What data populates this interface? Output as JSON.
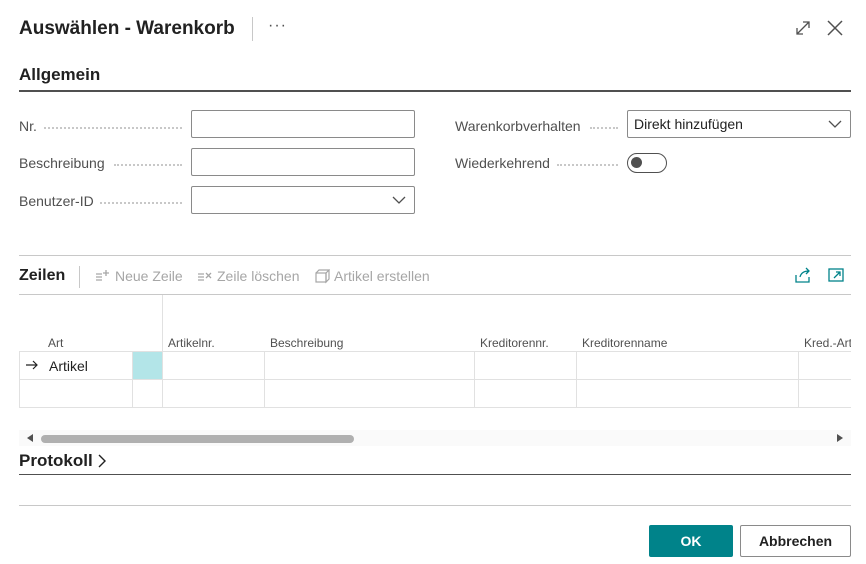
{
  "dialog": {
    "title": "Auswählen - Warenkorb",
    "more_label": "···"
  },
  "general": {
    "heading": "Allgemein",
    "fields": {
      "nr_label": "Nr.",
      "nr_value": "",
      "beschreibung_label": "Beschreibung",
      "beschreibung_value": "",
      "benutzer_label": "Benutzer-ID",
      "benutzer_value": "",
      "warenkorbverhalten_label": "Warenkorbverhalten",
      "warenkorbverhalten_value": "Direkt hinzufügen",
      "wiederkehrend_label": "Wiederkehrend",
      "wiederkehrend_on": false
    }
  },
  "lines": {
    "heading": "Zeilen",
    "toolbar": {
      "new_line": "Neue Zeile",
      "delete_line": "Zeile löschen",
      "create_item": "Artikel erstellen"
    },
    "columns": [
      "Art",
      "Artikelnr.",
      "Beschreibung",
      "Kreditorennr.",
      "Kreditorenname",
      "Kred.-Art"
    ],
    "rows": [
      {
        "art": "Artikel",
        "artikelnr": "",
        "beschreibung": "",
        "kreditorennr": "",
        "kreditorenname": "",
        "kredart": ""
      },
      {
        "art": "",
        "artikelnr": "",
        "beschreibung": "",
        "kreditorennr": "",
        "kreditorenname": "",
        "kredart": ""
      }
    ]
  },
  "protokoll": {
    "heading": "Protokoll"
  },
  "footer": {
    "ok_label": "OK",
    "cancel_label": "Abbrechen"
  },
  "colors": {
    "accent": "#00838a",
    "selection": "#b3e5e8"
  }
}
